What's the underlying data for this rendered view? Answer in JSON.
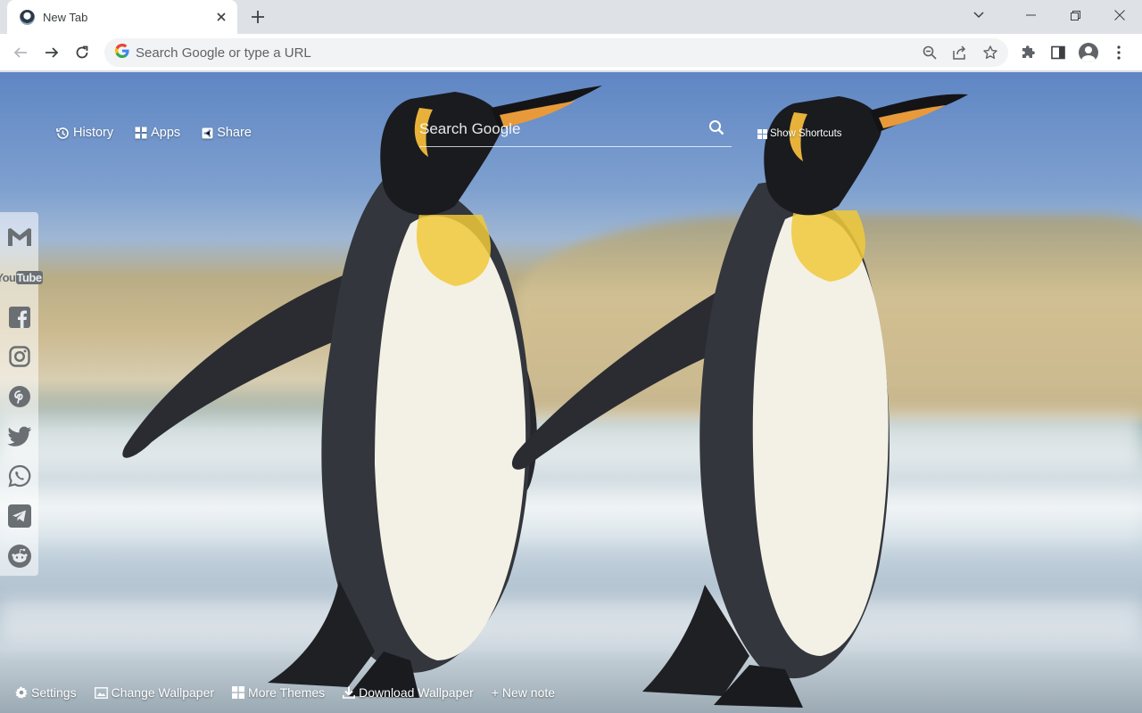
{
  "tab": {
    "title": "New Tab"
  },
  "omnibox": {
    "placeholder": "Search Google or type a URL"
  },
  "page": {
    "topnav": [
      {
        "label": "History",
        "icon": "history-icon"
      },
      {
        "label": "Apps",
        "icon": "apps-grid-icon"
      },
      {
        "label": "Share",
        "icon": "share-icon"
      }
    ],
    "search": {
      "placeholder": "Search Google"
    },
    "show_shortcuts": "Show Shortcuts",
    "social": [
      "gmail-icon",
      "youtube-icon",
      "facebook-icon",
      "instagram-icon",
      "pinterest-icon",
      "twitter-icon",
      "whatsapp-icon",
      "telegram-icon",
      "reddit-icon"
    ],
    "youtube_text": {
      "you": "You",
      "tube": "Tube"
    },
    "bottom": {
      "settings": "Settings",
      "change_wallpaper": "Change Wallpaper",
      "more_themes": "More Themes",
      "download_wallpaper": "Download Wallpaper",
      "new_note": "+ New note"
    }
  },
  "colors": {
    "chrome_bg": "#dee1e6",
    "omnibox_bg": "#f1f3f4",
    "icon_gray": "#5f6368"
  }
}
